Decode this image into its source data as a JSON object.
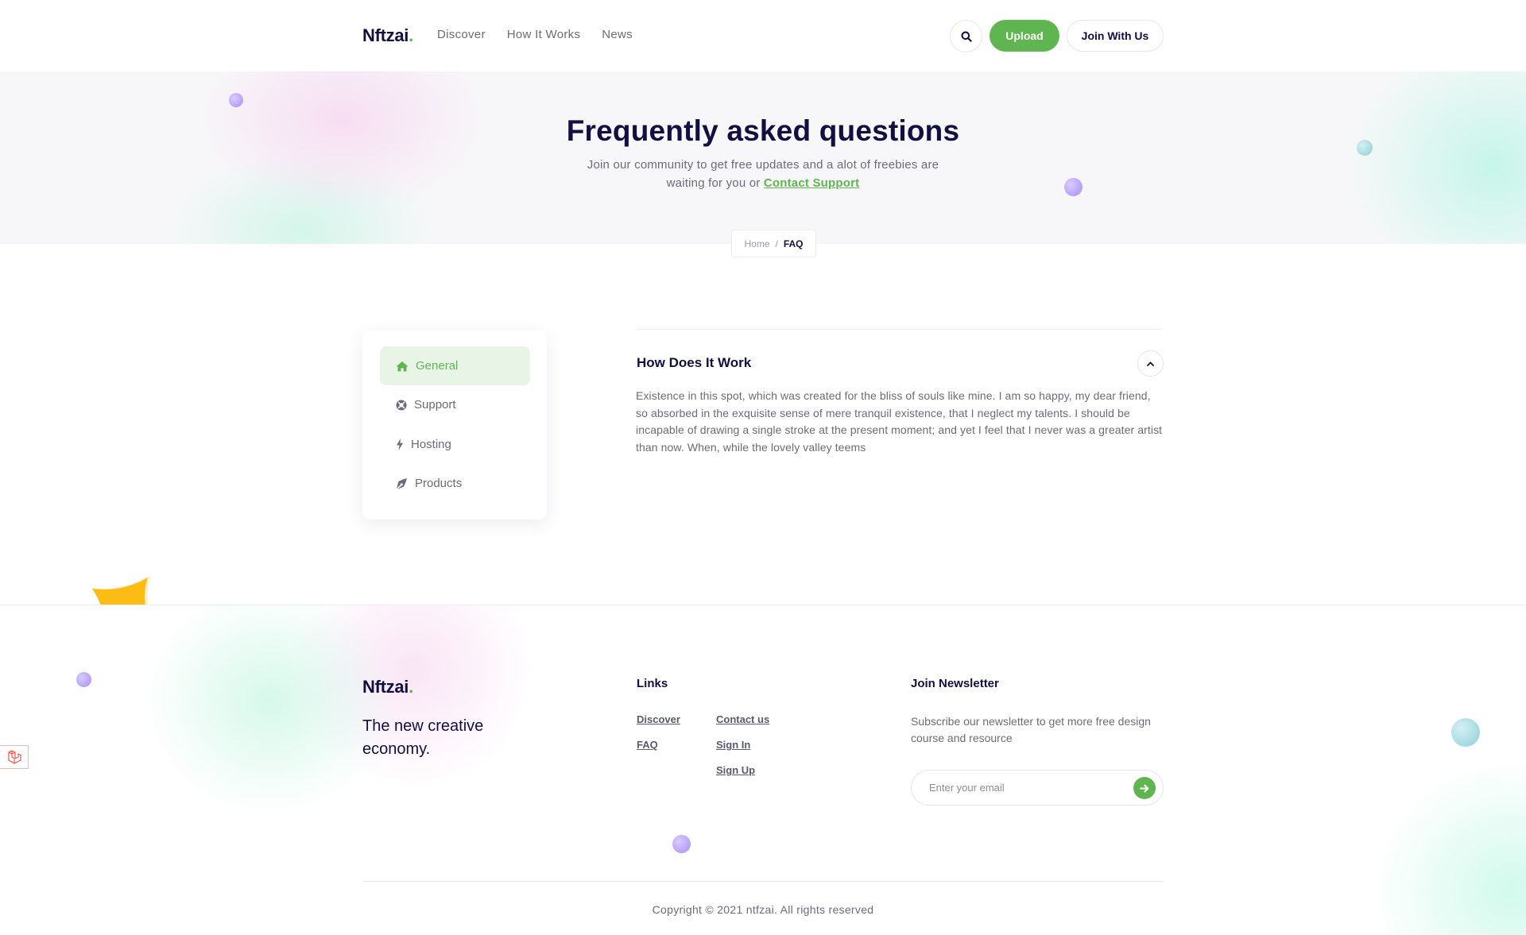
{
  "brand": {
    "name": "Nftzai",
    "dot": ".",
    "accent_color": "#5fb650",
    "text_color": "#130f40"
  },
  "header": {
    "nav": [
      "Discover",
      "How It Works",
      "News"
    ],
    "search_icon": "search-icon",
    "upload_label": "Upload",
    "join_label": "Join With Us"
  },
  "hero": {
    "title": "Frequently asked questions",
    "subtitle": "Join our community to get free updates and a alot of freebies are waiting for you or",
    "link": "Contact Support"
  },
  "breadcrumb": {
    "home": "Home",
    "separator": "/",
    "current": "FAQ"
  },
  "sidebar": {
    "items": [
      {
        "label": "General",
        "icon": "home-icon",
        "active": true
      },
      {
        "label": "Support",
        "icon": "support-icon",
        "active": false
      },
      {
        "label": "Hosting",
        "icon": "bolt-icon",
        "active": false
      },
      {
        "label": "Products",
        "icon": "pen-nib-icon",
        "active": false
      }
    ]
  },
  "faq": {
    "question": "How Does It Work",
    "answer": "Existence in this spot, which was created for the bliss of souls like mine. I am so happy, my dear friend, so absorbed in the exquisite sense of mere tranquil existence, that I neglect my talents. I should be incapable of drawing a single stroke at the present moment; and yet I feel that I never was a greater artist than now. When, while the lovely valley teems",
    "expanded": true
  },
  "footer": {
    "tagline": "The new creative economy.",
    "links_title": "Links",
    "links": [
      "Discover",
      "FAQ",
      "Contact us",
      "Sign In",
      "Sign Up"
    ],
    "newsletter_title": "Join Newsletter",
    "newsletter_text": "Subscribe our newsletter to get more free design course and resource",
    "email_placeholder": "Enter your email",
    "copyright": "Copyright © 2021 ntfzai. All rights reserved"
  }
}
